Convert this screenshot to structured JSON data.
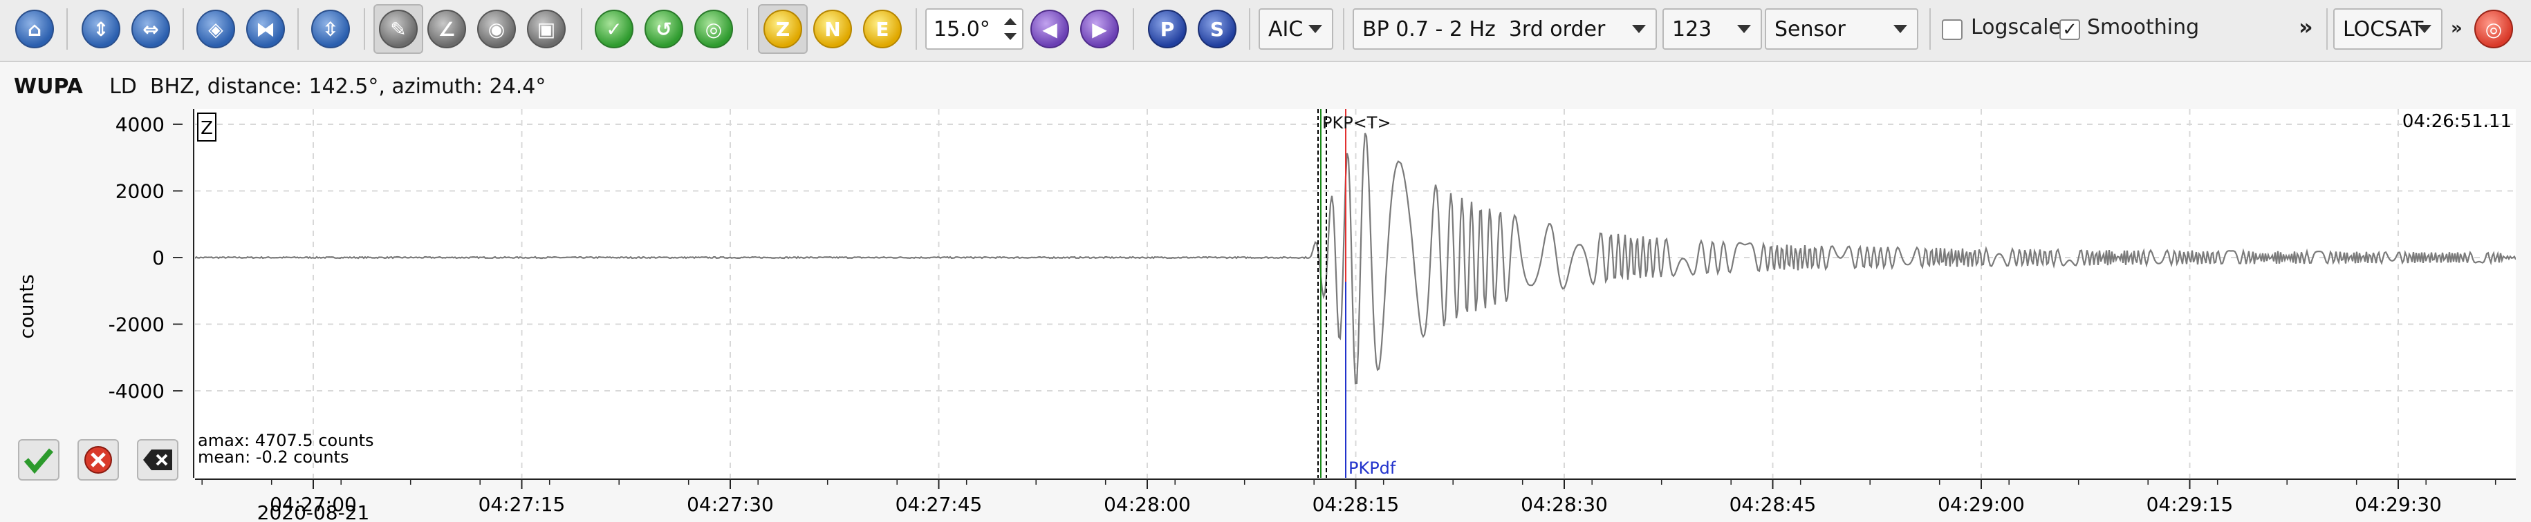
{
  "toolbar": {
    "zoom_value": "15.0°",
    "picker_method": "AIC",
    "filter": "BP 0.7 - 2 Hz  3rd order",
    "component_mode": "123",
    "unit_mode": "Sensor",
    "logscale_label": "Logscale",
    "logscale_checked": false,
    "smoothing_label": "Smoothing",
    "smoothing_checked": true,
    "more_glyph": "»",
    "locator": "LOCSAT",
    "button_letters": {
      "z": "Z",
      "n": "N",
      "e": "E",
      "p": "P",
      "s": "S"
    }
  },
  "trace": {
    "station": "WUPA",
    "location_channel": "LD  BHZ",
    "info": ", distance: 142.5°, azimuth: 24.4°",
    "component_label": "Z",
    "y_axis_label": "counts",
    "time_label": "04:26:51.11",
    "amax": "amax: 4707.5 counts",
    "mean": "mean: -0.2 counts",
    "date": "2020-08-21",
    "pick_labels": {
      "theoretical": "PKP<T>",
      "manual": "PKPdf"
    },
    "y_ticks": [
      "4000",
      "2000",
      "0",
      "-2000",
      "-4000"
    ],
    "x_ticks": [
      "04:27:00",
      "04:27:15",
      "04:27:30",
      "04:27:45",
      "04:28:00",
      "04:28:15",
      "04:28:30",
      "04:28:45",
      "04:29:00",
      "04:29:15",
      "04:29:30"
    ]
  },
  "colors": {
    "trace": "#7a7a7a",
    "theoretical_pick": "#1a8a1a",
    "manual_pick": "#2233cc",
    "red_marker": "#e23030"
  }
}
